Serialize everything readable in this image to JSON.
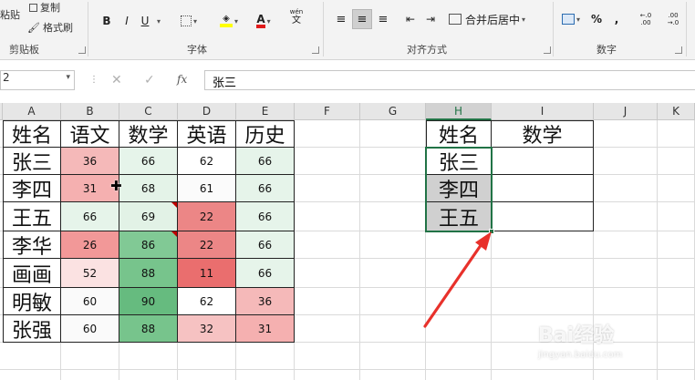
{
  "ribbon": {
    "clipboard": {
      "paste": "粘贴",
      "copy": "复制",
      "format_painter": "格式刷",
      "label": "剪贴板"
    },
    "font": {
      "bold": "B",
      "italic": "I",
      "underline": "U",
      "font_color": "A",
      "phonetic": "wén",
      "label": "字体"
    },
    "alignment": {
      "merge_center": "合并后居中",
      "label": "对齐方式"
    },
    "number": {
      "percent": "%",
      "comma": ",",
      "increase_decimal": "←.0 .00",
      "decrease_decimal": ".00 →.0",
      "label": "数字"
    }
  },
  "formula_bar": {
    "name_box": "2",
    "fx": "fx",
    "content": "张三"
  },
  "grid": {
    "columns": [
      "A",
      "B",
      "C",
      "D",
      "E",
      "F",
      "G",
      "H",
      "I",
      "J",
      "K"
    ],
    "headers": [
      "姓名",
      "语文",
      "数学",
      "英语",
      "历史"
    ],
    "rows": [
      {
        "name": "张三",
        "b": "36",
        "c": "66",
        "d": "62",
        "e": "66"
      },
      {
        "name": "李四",
        "b": "31",
        "c": "68",
        "d": "61",
        "e": "66"
      },
      {
        "name": "王五",
        "b": "66",
        "c": "69",
        "d": "22",
        "e": "66"
      },
      {
        "name": "李华",
        "b": "26",
        "c": "86",
        "d": "22",
        "e": "66"
      },
      {
        "name": "画画",
        "b": "52",
        "c": "88",
        "d": "11",
        "e": "66"
      },
      {
        "name": "明敏",
        "b": "60",
        "c": "90",
        "d": "62",
        "e": "36"
      },
      {
        "name": "张强",
        "b": "60",
        "c": "88",
        "d": "32",
        "e": "31"
      }
    ],
    "colors": [
      [
        "#f5b9b9",
        "#e6f4ea",
        "#ffffff",
        "#e6f4ea"
      ],
      [
        "#f5b0b0",
        "#e4f3e8",
        "#fbfbfb",
        "#e6f4ea"
      ],
      [
        "#e6f4ea",
        "#e2f2e6",
        "#ec8686",
        "#e6f4ea"
      ],
      [
        "#f29898",
        "#81c995",
        "#ec8686",
        "#e6f4ea"
      ],
      [
        "#fbe2e2",
        "#77c48c",
        "#ea6e6e",
        "#e6f4ea"
      ],
      [
        "#fafafa",
        "#66bb7f",
        "#ffffff",
        "#f5b9b9"
      ],
      [
        "#fafafa",
        "#77c48c",
        "#f6c2c2",
        "#f5b0b0"
      ]
    ],
    "right_table": {
      "headers": [
        "姓名",
        "数学"
      ],
      "names": [
        "张三",
        "李四",
        "王五"
      ]
    }
  },
  "watermark": {
    "brand": "Bai经验",
    "url": "jingyan.baidu.com"
  },
  "accent": "#217346",
  "arrow_color": "#e8312b"
}
